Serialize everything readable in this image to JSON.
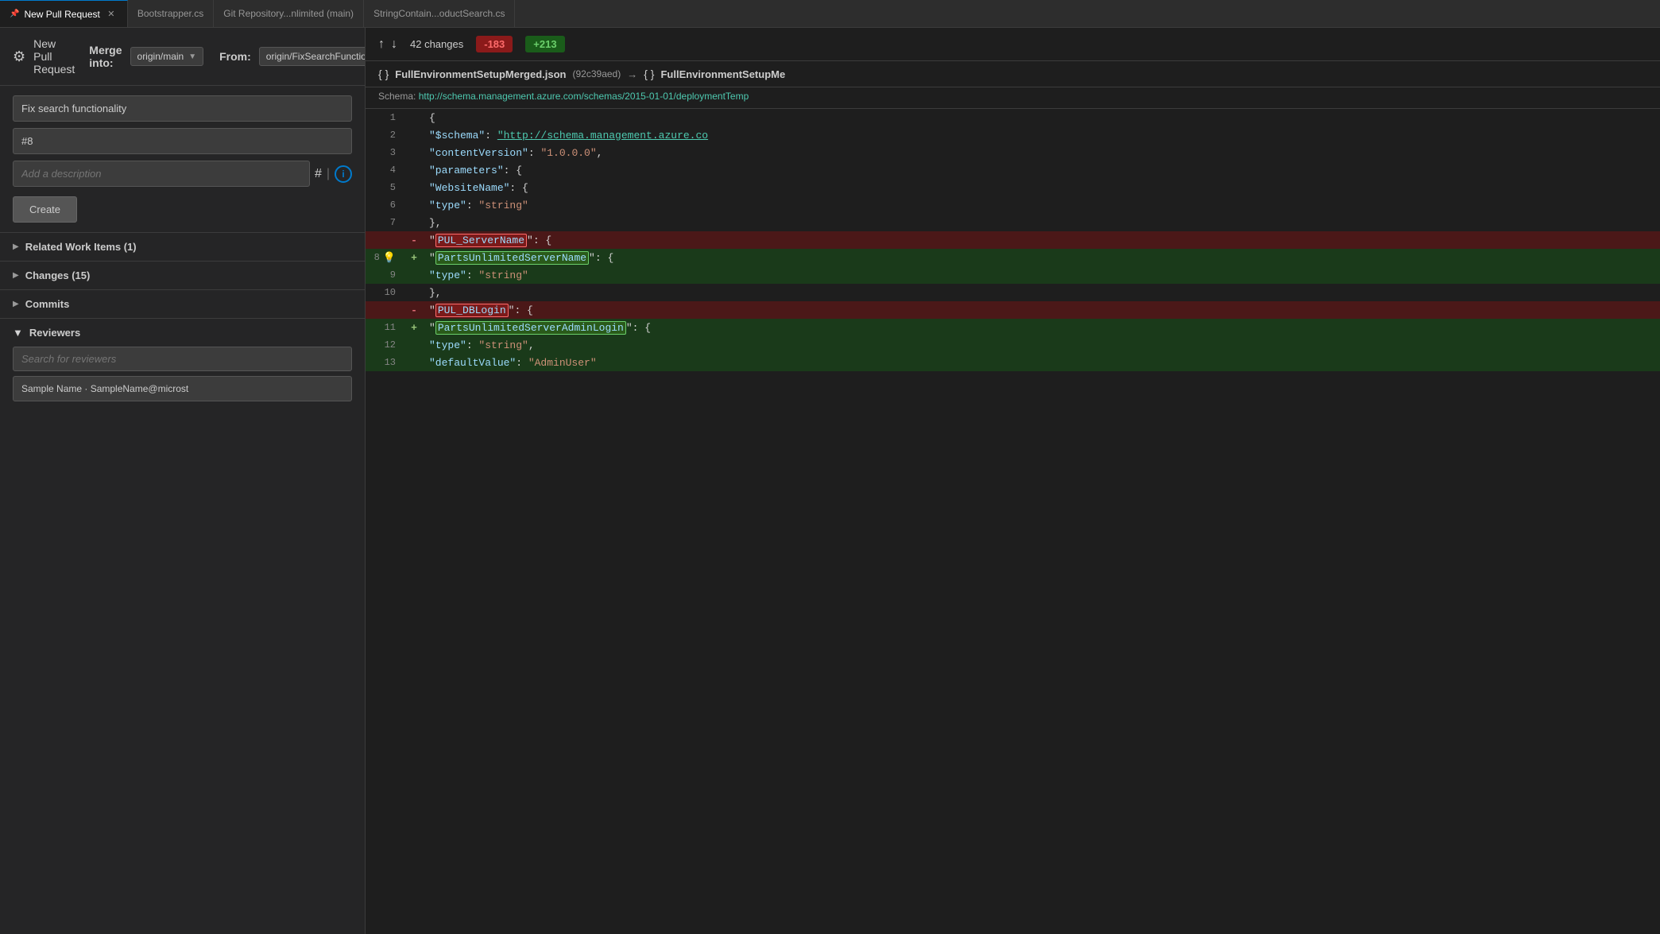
{
  "tabs": [
    {
      "label": "New Pull Request",
      "active": true,
      "pinned": true
    },
    {
      "label": "Bootstrapper.cs",
      "active": false
    },
    {
      "label": "Git Repository...nlimited (main)",
      "active": false
    },
    {
      "label": "StringContain...oductSearch.cs",
      "active": false
    }
  ],
  "header": {
    "pr_icon": "⚙",
    "pr_title": "New Pull Request",
    "merge_into_label": "Merge into:",
    "merge_branch": "origin/main",
    "from_label": "From:",
    "from_branch": "origin/FixSearchFunctionality"
  },
  "form": {
    "title_value": "Fix search functionality",
    "pr_number": "#8",
    "description_placeholder": "Add a description",
    "create_label": "Create"
  },
  "sections": [
    {
      "label": "Related Work Items (1)",
      "expanded": false
    },
    {
      "label": "Changes (15)",
      "expanded": false
    },
    {
      "label": "Commits",
      "expanded": false
    }
  ],
  "reviewers": {
    "title": "Reviewers",
    "search_placeholder": "Search for reviewers",
    "reviewer": "Sample Name · SampleName@microst"
  },
  "diff": {
    "changes_count": "42 changes",
    "deletions": "-183",
    "additions": "+213",
    "file_name": "FullEnvironmentSetupMerged.json",
    "file_hash": "(92c39aed)",
    "arrow": "→",
    "file_name_right": "FullEnvironmentSetupMe",
    "schema_label": "Schema:",
    "schema_url": "http://schema.management.azure.com/schemas/2015-01-01/deploymentTemp"
  },
  "code": [
    {
      "num": "1",
      "type": "normal",
      "content": "    {"
    },
    {
      "num": "2",
      "type": "normal",
      "content": "        \"$schema\":  \"http://schema.management.azure.co"
    },
    {
      "num": "3",
      "type": "normal",
      "content": "        \"contentVersion\": \"1.0.0.0\","
    },
    {
      "num": "4",
      "type": "normal",
      "content": "        \"parameters\": {"
    },
    {
      "num": "5",
      "type": "normal",
      "content": "            \"WebsiteName\": {"
    },
    {
      "num": "6",
      "type": "normal",
      "content": "                \"type\": \"string\""
    },
    {
      "num": "7",
      "type": "normal",
      "content": "            },"
    },
    {
      "num": "",
      "type": "deleted",
      "indicator": "-",
      "content_del": "            \"PUL_ServerName\": {",
      "highlight": "PUL_ServerName"
    },
    {
      "num": "8",
      "type": "added",
      "indicator": "+",
      "content_add": "            \"PartsUnlimitedServerName\": {",
      "highlight": "PartsUnlimitedServerName",
      "lightbulb": true
    },
    {
      "num": "9",
      "type": "added",
      "content": "                \"type\": \"string\""
    },
    {
      "num": "10",
      "type": "normal",
      "content": "            },"
    },
    {
      "num": "",
      "type": "deleted",
      "indicator": "-",
      "content_del": "            \"PUL_DBLogin\": {",
      "highlight": "PUL_DBLogin"
    },
    {
      "num": "11",
      "type": "added",
      "indicator": "+",
      "content_add": "            \"PartsUnlimitedServerAdminLogin\": {",
      "highlight": "PartsUnlimitedServerAdminLogin"
    },
    {
      "num": "12",
      "type": "added",
      "content": "                \"type\": \"string\","
    },
    {
      "num": "13",
      "type": "added",
      "content": "                \"defaultValue\": \"AdminUser\""
    }
  ]
}
